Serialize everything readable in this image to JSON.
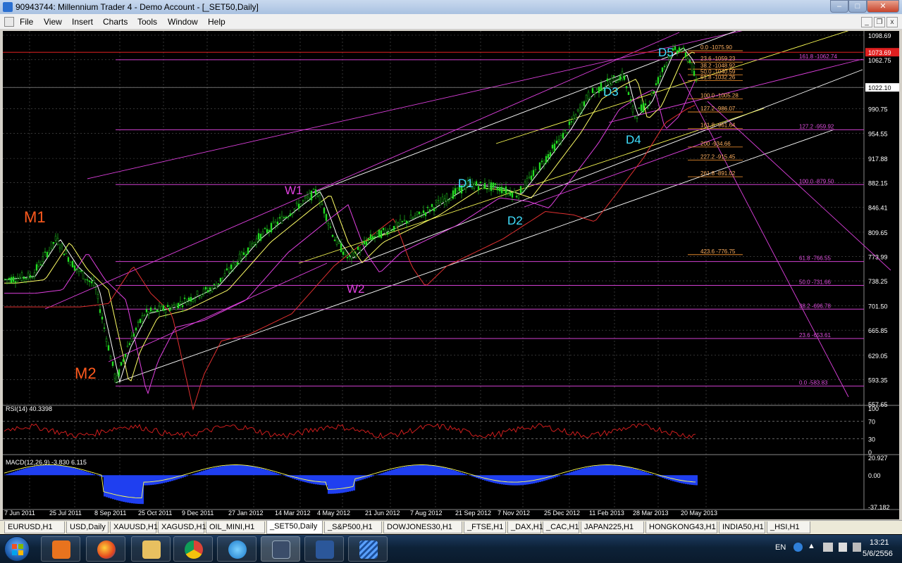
{
  "window": {
    "title": "90943744: Millennium Trader 4 - Demo Account - [_SET50,Daily]",
    "min_glyph": "–",
    "max_glyph": "□",
    "close_glyph": "✕"
  },
  "menu": {
    "items": [
      "File",
      "View",
      "Insert",
      "Charts",
      "Tools",
      "Window",
      "Help"
    ]
  },
  "mdi": {
    "min_glyph": "_",
    "restore_glyph": "❐",
    "close_glyph": "x"
  },
  "chart_data": {
    "type": "candlestick",
    "symbol": "_SET50,Daily",
    "y_axis_ticks": [
      "1098.69",
      "1062.75",
      "1022.10",
      "990.75",
      "954.55",
      "917.88",
      "882.15",
      "846.41",
      "809.65",
      "773.99",
      "738.25",
      "701.50",
      "665.85",
      "629.05",
      "593.35",
      "557.65"
    ],
    "ylim": [
      557.65,
      1098.69
    ],
    "x_axis_ticks": [
      "7 Jun 2011",
      "25 Jul 2011",
      "8 Sep 2011",
      "25 Oct 2011",
      "9 Dec 2011",
      "27 Jan 2012",
      "14 Mar 2012",
      "4 May 2012",
      "21 Jun 2012",
      "7 Aug 2012",
      "21 Sep 2012",
      "7 Nov 2012",
      "25 Dec 2012",
      "11 Feb 2013",
      "28 Mar 2013",
      "20 May 2013"
    ],
    "current_price_label": "1022.10",
    "redline_price_label": "1073.69",
    "wave_labels": [
      {
        "text": "M1",
        "color": "#ff5a1e"
      },
      {
        "text": "M2",
        "color": "#ff5a1e"
      },
      {
        "text": "W1",
        "color": "#e040e0"
      },
      {
        "text": "W2",
        "color": "#e040e0"
      },
      {
        "text": "D1",
        "color": "#40e0ff"
      },
      {
        "text": "D2",
        "color": "#40e0ff"
      },
      {
        "text": "D3",
        "color": "#40e0ff"
      },
      {
        "text": "D4",
        "color": "#40e0ff"
      },
      {
        "text": "D5",
        "color": "#40e0ff"
      }
    ],
    "fib_small": [
      "0.0 -1075.90",
      "23.6 -1059.23",
      "38.2 -1048.92",
      "50.0 -1040.59",
      "61.8 -1032.26",
      "100.0 -1005.28",
      "127.2 -986.07",
      "161.8 -961.64",
      "200 -934.66",
      "227.2 -915.45",
      "261.8 -891.02",
      "423.6 -776.75"
    ],
    "fib_large": [
      "161.8 -1062.74",
      "127.2 -959.92",
      "100.0 -879.50",
      "61.8 -766.55",
      "50.0 -731.66",
      "38.2 -696.78",
      "23.6 -653.61",
      "0.0 -583.83"
    ],
    "rsi": {
      "label": "RSI(14) 40.3398",
      "ticks": [
        "100",
        "70",
        "30",
        "0"
      ],
      "levels": [
        70,
        30
      ]
    },
    "macd": {
      "label": "MACD(12,26,9) -3.830 6.115",
      "ticks": [
        "20.927",
        "0.00",
        "-37.182"
      ]
    }
  },
  "tabs": [
    "EURUSD,H1",
    "USD,Daily",
    "XAUUSD,H1",
    "XAGUSD,H1",
    "OIL_MINI,H1",
    "_SET50,Daily",
    "_S&P500,H1",
    "DOWJONES30,H1",
    "_FTSE,H1",
    "_DAX,H1",
    "_CAC,H1",
    "JAPAN225,H1",
    "HONGKONG43,H1",
    "INDIA50,H1",
    "_HSI,H1"
  ],
  "active_tab": "_SET50,Daily",
  "taskbar": {
    "apps": [
      "media-player",
      "firefox",
      "file-explorer",
      "chrome",
      "internet-explorer",
      "metatrader",
      "word",
      "trader-app"
    ],
    "lang": "EN",
    "time": "13:21",
    "date": "5/6/2556"
  }
}
